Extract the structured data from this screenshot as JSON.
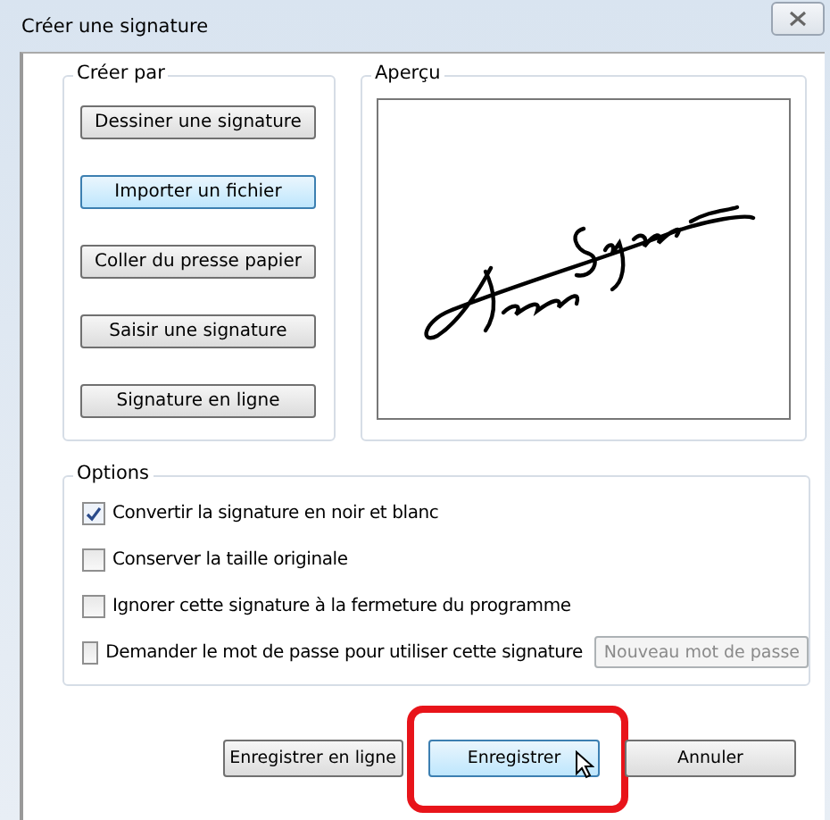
{
  "window": {
    "title": "Créer une signature"
  },
  "create_by": {
    "title": "Créer par",
    "buttons": [
      {
        "label": "Dessiner une signature",
        "selected": false
      },
      {
        "label": "Importer un fichier",
        "selected": true
      },
      {
        "label": "Coller du presse papier",
        "selected": false
      },
      {
        "label": "Saisir une signature",
        "selected": false
      },
      {
        "label": "Signature en ligne",
        "selected": false
      }
    ]
  },
  "preview": {
    "title": "Aperçu"
  },
  "options": {
    "title": "Options",
    "items": [
      {
        "label": "Convertir la signature en noir et blanc",
        "checked": true
      },
      {
        "label": "Conserver la taille originale",
        "checked": false
      },
      {
        "label": "Ignorer cette signature à la fermeture du programme",
        "checked": false
      },
      {
        "label": "Demander le mot de passe pour utiliser cette signature",
        "checked": false,
        "button": {
          "label": "Nouveau mot de passe",
          "disabled": true
        }
      }
    ]
  },
  "footer_buttons": [
    {
      "label": "Enregistrer en ligne",
      "selected": false,
      "highlighted": false
    },
    {
      "label": "Enregistrer",
      "selected": true,
      "highlighted": true
    },
    {
      "label": "Annuler",
      "selected": false,
      "highlighted": false
    }
  ]
}
